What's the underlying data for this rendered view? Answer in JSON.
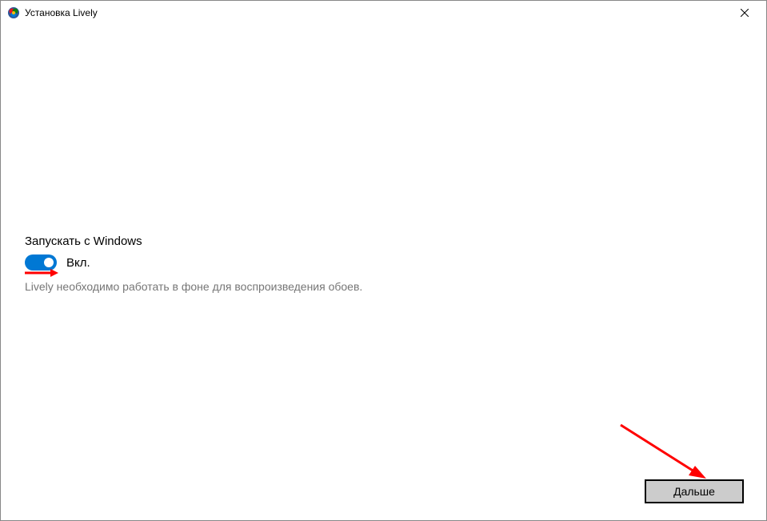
{
  "window": {
    "title": "Установка Lively"
  },
  "setting": {
    "label": "Запускать с Windows",
    "toggle_state": "Вкл.",
    "description": "Lively необходимо работать в фоне для воспроизведения обоев."
  },
  "footer": {
    "next_label": "Дальше"
  },
  "colors": {
    "accent": "#0078d4",
    "arrow": "#ff0000"
  }
}
